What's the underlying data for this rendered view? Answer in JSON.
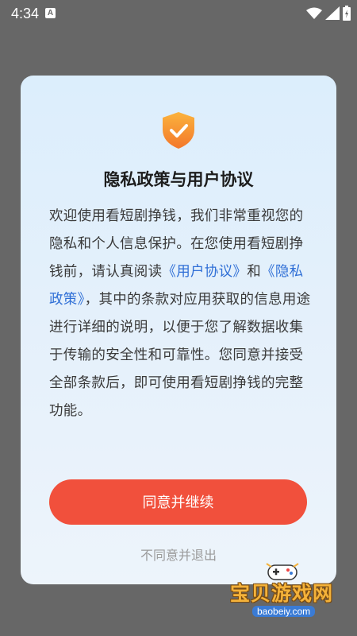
{
  "status_bar": {
    "time": "4:34",
    "notification_icon": "A",
    "icons": [
      "wifi-icon",
      "signal-icon",
      "battery-charging-icon"
    ]
  },
  "dialog": {
    "icon": "shield-check-icon",
    "title": "隐私政策与用户协议",
    "body_part1": "欢迎使用看短剧挣钱，我们非常重视您的隐私和个人信息保护。在您使用看短剧挣钱前，请认真阅读",
    "user_agreement_link": "《用户协议》",
    "body_and": "和",
    "privacy_policy_link": "《隐私政策》",
    "body_part2": "，其中的条款对应用获取的信息用途进行详细的说明，以便于您了解数据收集于传输的安全性和可靠性。您同意并接受全部条款后，即可使用看短剧挣钱的完整功能。",
    "agree_button": "同意并继续",
    "decline_link": "不同意并退出"
  },
  "watermark": {
    "text_cn": "宝贝游戏网",
    "text_en": "baobeiy.com"
  },
  "colors": {
    "accent_button": "#f1503c",
    "link": "#2f6fd6",
    "shield": "#f7a531",
    "overlay": "#676767"
  }
}
